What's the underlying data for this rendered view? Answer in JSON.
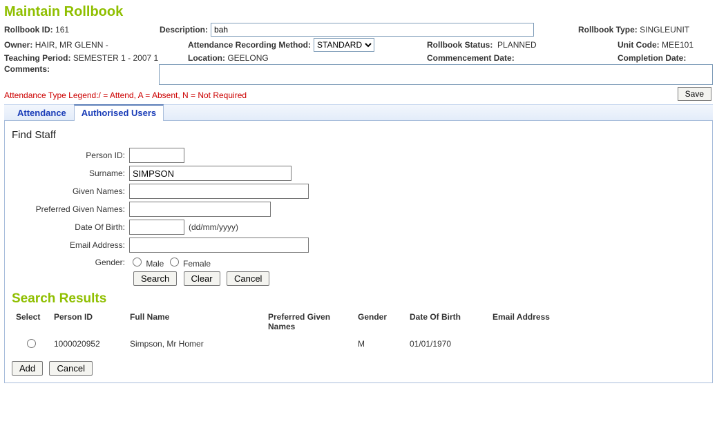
{
  "page_title": "Maintain Rollbook",
  "labels": {
    "rollbook_id": "Rollbook ID:",
    "description": "Description:",
    "rollbook_type": "Rollbook Type:",
    "owner": "Owner:",
    "att_method": "Attendance Recording Method:",
    "rollbook_status": "Rollbook Status:",
    "unit_code": "Unit Code:",
    "teaching_period": "Teaching Period:",
    "location": "Location:",
    "commencement": "Commencement Date:",
    "completion": "Completion Date:",
    "comments": "Comments:"
  },
  "values": {
    "rollbook_id": "161",
    "description": "bah",
    "rollbook_type": "SINGLEUNIT",
    "owner": "HAIR, MR GLENN -",
    "att_method_selected": "STANDARD",
    "rollbook_status": "PLANNED",
    "unit_code": "MEE101",
    "teaching_period": "SEMESTER 1 - 2007 1",
    "location": "GEELONG",
    "commencement": "",
    "completion": "",
    "comments": ""
  },
  "legend_text": "Attendance Type Legend:/ = Attend,  A = Absent,  N = Not Required",
  "buttons": {
    "save": "Save",
    "search": "Search",
    "clear": "Clear",
    "cancel": "Cancel",
    "add": "Add",
    "cancel2": "Cancel"
  },
  "tabs": {
    "attendance": "Attendance",
    "auth_users": "Authorised Users"
  },
  "find_staff": {
    "heading": "Find Staff",
    "labels": {
      "person_id": "Person ID:",
      "surname": "Surname:",
      "given_names": "Given Names:",
      "pref_given_names": "Preferred Given Names:",
      "dob": "Date Of Birth:",
      "dob_hint": "(dd/mm/yyyy)",
      "email": "Email Address:",
      "gender": "Gender:",
      "male": "Male",
      "female": "Female"
    },
    "values": {
      "person_id": "",
      "surname": "SIMPSON",
      "given_names": "",
      "pref_given_names": "",
      "dob": "",
      "email": ""
    }
  },
  "results": {
    "heading": "Search Results",
    "columns": {
      "select": "Select",
      "person_id": "Person ID",
      "full_name": "Full Name",
      "pref_given": "Preferred Given Names",
      "gender": "Gender",
      "dob": "Date Of Birth",
      "email": "Email Address"
    },
    "rows": [
      {
        "person_id": "1000020952",
        "full_name": "Simpson, Mr Homer",
        "pref_given": "",
        "gender": "M",
        "dob": "01/01/1970",
        "email": ""
      }
    ]
  }
}
